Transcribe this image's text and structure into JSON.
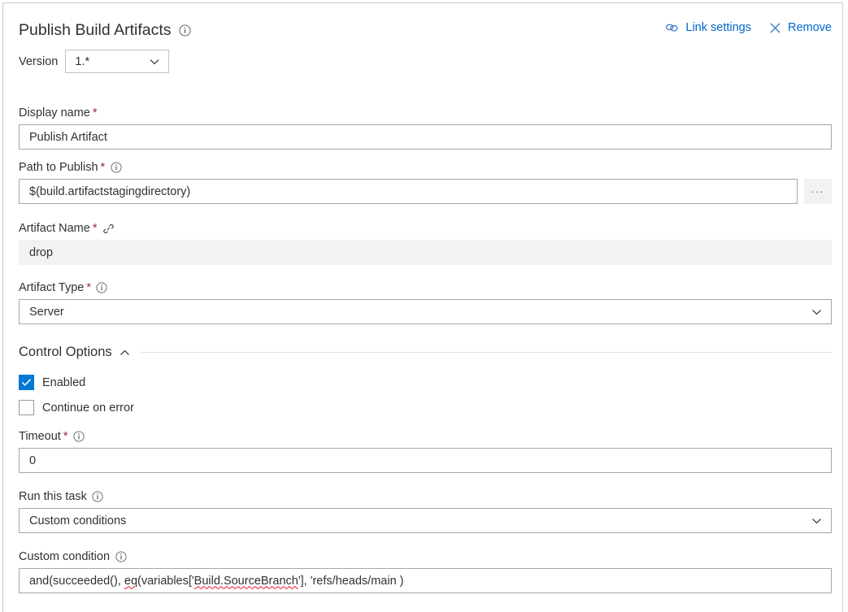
{
  "header": {
    "title": "Publish Build Artifacts",
    "title_info_icon": "info-circle-icon",
    "link_settings_label": "Link settings",
    "link_settings_icon": "chain-link-icon",
    "remove_label": "Remove",
    "remove_icon": "close-x-icon"
  },
  "version": {
    "label": "Version",
    "value": "1.*",
    "chevron_icon": "chevron-down-icon"
  },
  "fields": {
    "display_name": {
      "label": "Display name",
      "required": "*",
      "value": "Publish Artifact"
    },
    "path_to_publish": {
      "label": "Path to Publish",
      "required": "*",
      "info_icon": "info-circle-icon",
      "value": "$(build.artifactstagingdirectory)",
      "browse_label": "...",
      "browse_icon": "ellipsis-icon"
    },
    "artifact_name": {
      "label": "Artifact Name",
      "required": "*",
      "link_icon": "chain-link-icon",
      "value": "drop",
      "readonly": true
    },
    "artifact_type": {
      "label": "Artifact Type",
      "required": "*",
      "info_icon": "info-circle-icon",
      "value": "Server",
      "chevron_icon": "chevron-down-icon"
    }
  },
  "control_options": {
    "title": "Control Options",
    "collapse_icon": "chevron-up-icon",
    "enabled": {
      "label": "Enabled",
      "checked": true,
      "check_icon": "checkmark-icon"
    },
    "continue_on_error": {
      "label": "Continue on error",
      "checked": false
    },
    "timeout": {
      "label": "Timeout",
      "required": "*",
      "info_icon": "info-circle-icon",
      "value": "0"
    },
    "run_this_task": {
      "label": "Run this task",
      "info_icon": "info-circle-icon",
      "value": "Custom conditions",
      "chevron_icon": "chevron-down-icon"
    },
    "custom_condition": {
      "label": "Custom condition",
      "info_icon": "info-circle-icon",
      "value": "and(succeeded(), eq(variables['Build.SourceBranch'], 'refs/heads/main )",
      "segments": [
        {
          "text": "and(succeeded(), ",
          "spellcheck_error": false
        },
        {
          "text": "eq",
          "spellcheck_error": true
        },
        {
          "text": "(variables['",
          "spellcheck_error": false
        },
        {
          "text": "Build.SourceBranch",
          "spellcheck_error": true
        },
        {
          "text": "'], 'refs/heads/main )",
          "spellcheck_error": false
        }
      ]
    }
  },
  "colors": {
    "accent": "#0078d4",
    "link": "#0066cc",
    "required_asterisk": "#a4262c",
    "spellcheck_underline": "#e81123",
    "readonly_background": "#f3f2f1",
    "border": "#a9a7a5"
  }
}
